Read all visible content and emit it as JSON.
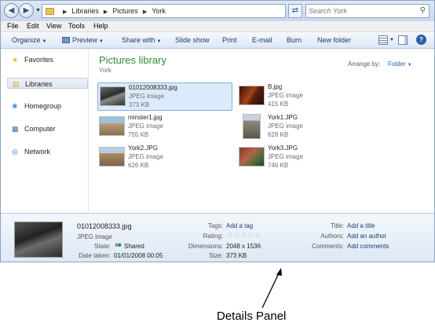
{
  "address": {
    "breadcrumbs": [
      "Libraries",
      "Pictures",
      "York"
    ],
    "search_placeholder": "Search York"
  },
  "menu": [
    "File",
    "Edit",
    "View",
    "Tools",
    "Help"
  ],
  "commands": {
    "organize": "Organize",
    "preview": "Preview",
    "share_with": "Share with",
    "slide_show": "Slide show",
    "print": "Print",
    "email": "E-mail",
    "burn": "Burn",
    "new_folder": "New folder"
  },
  "nav": {
    "favorites": "Favorites",
    "libraries": "Libraries",
    "homegroup": "Homegroup",
    "computer": "Computer",
    "network": "Network"
  },
  "library": {
    "title": "Pictures library",
    "subtitle": "York",
    "arrange_label": "Arrange by:",
    "arrange_value": "Folder"
  },
  "files": [
    {
      "name": "01012008333.jpg",
      "type": "JPEG image",
      "size": "373 KB"
    },
    {
      "name": "B.jpg",
      "type": "JPEG image",
      "size": "415 KB"
    },
    {
      "name": "minster1.jpg",
      "type": "JPEG image",
      "size": "755 KB"
    },
    {
      "name": "York1.JPG",
      "type": "JPEG image",
      "size": "628 KB"
    },
    {
      "name": "York2.JPG",
      "type": "JPEG image",
      "size": "626 KB"
    },
    {
      "name": "York3.JPG",
      "type": "JPEG image",
      "size": "746 KB"
    }
  ],
  "details": {
    "name": "01012008333.jpg",
    "type": "JPEG image",
    "state_label": "State:",
    "state_value": "Shared",
    "date_label": "Date taken:",
    "date_value": "01/01/2008 00:05",
    "tags_label": "Tags:",
    "tags_value": "Add a tag",
    "rating_label": "Rating:",
    "rating_value": 0,
    "dimensions_label": "Dimensions:",
    "dimensions_value": "2048 x 1536",
    "size_label": "Size:",
    "size_value": "373 KB",
    "title_label": "Title:",
    "title_value": "Add a title",
    "authors_label": "Authors:",
    "authors_value": "Add an author",
    "comments_label": "Comments:",
    "comments_value": "Add comments"
  },
  "annotation": "Details Panel",
  "colors": {
    "library_title": "#2f8b38",
    "link": "#1e3c6e",
    "selection": "#dcebfc"
  }
}
